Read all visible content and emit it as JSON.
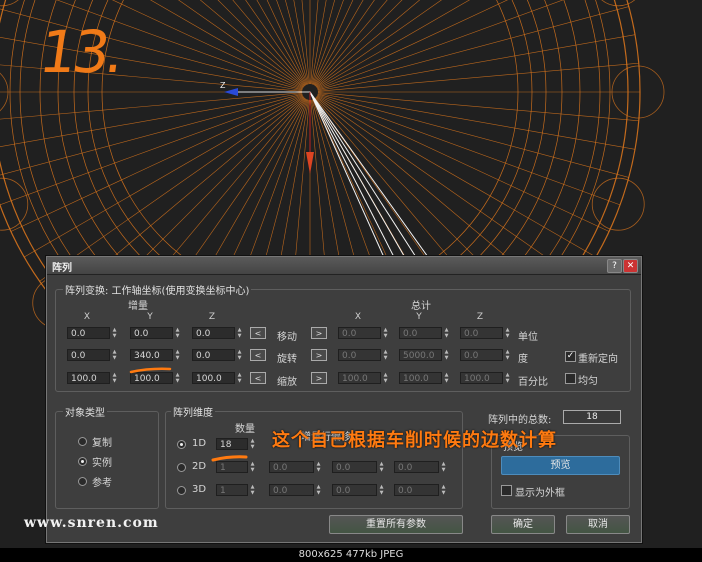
{
  "overlay": {
    "step_number": "13.",
    "dialog_annotation": "阵列",
    "count_annotation": "这个自己根据车削时候的边数计算",
    "watermark": "www.snren.com",
    "image_info": "800x625  477kb  JPEG"
  },
  "viewport": {
    "axis_label": "Z",
    "wire_color": "#e0781c",
    "background": "#202020"
  },
  "dialog": {
    "title": "阵列",
    "transform_group_label": "阵列变换: 工作轴坐标(使用变换坐标中心)",
    "increment_header": "增量",
    "total_header": "总计",
    "axis_labels": [
      "X",
      "Y",
      "Z"
    ],
    "rows": [
      {
        "label": "移动",
        "inc": [
          "0.0",
          "0.0",
          "0.0"
        ],
        "total": [
          "0.0",
          "0.0",
          "0.0"
        ],
        "unit": "单位"
      },
      {
        "label": "旋转",
        "inc": [
          "0.0",
          "340.0",
          "0.0"
        ],
        "total": [
          "0.0",
          "5000.0",
          "0.0"
        ],
        "unit": "度"
      },
      {
        "label": "缩放",
        "inc": [
          "100.0",
          "100.0",
          "100.0"
        ],
        "total": [
          "100.0",
          "100.0",
          "100.0"
        ],
        "unit": "百分比"
      }
    ],
    "reorient": {
      "label": "重新定向",
      "checked": true
    },
    "uniform": {
      "label": "均匀",
      "checked": false
    },
    "object_type": {
      "label": "对象类型",
      "options": [
        "复制",
        "实例",
        "参考"
      ],
      "selected": "实例"
    },
    "dimensions": {
      "label": "阵列维度",
      "count_header": "数量",
      "offset_header": "增量行偏移",
      "rows": [
        {
          "label": "1D",
          "count": "18",
          "selected": true
        },
        {
          "label": "2D",
          "count": "1",
          "offsets": [
            "0.0",
            "0.0",
            "0.0"
          ]
        },
        {
          "label": "3D",
          "count": "1",
          "offsets": [
            "0.0",
            "0.0",
            "0.0"
          ]
        }
      ]
    },
    "total_in_array_label": "阵列中的总数:",
    "total_in_array_value": "18",
    "preview_label": "预览",
    "preview_button": "预览",
    "display_as_box_label": "显示为外框",
    "reset_button": "重置所有参数",
    "ok_button": "确定",
    "cancel_button": "取消"
  }
}
